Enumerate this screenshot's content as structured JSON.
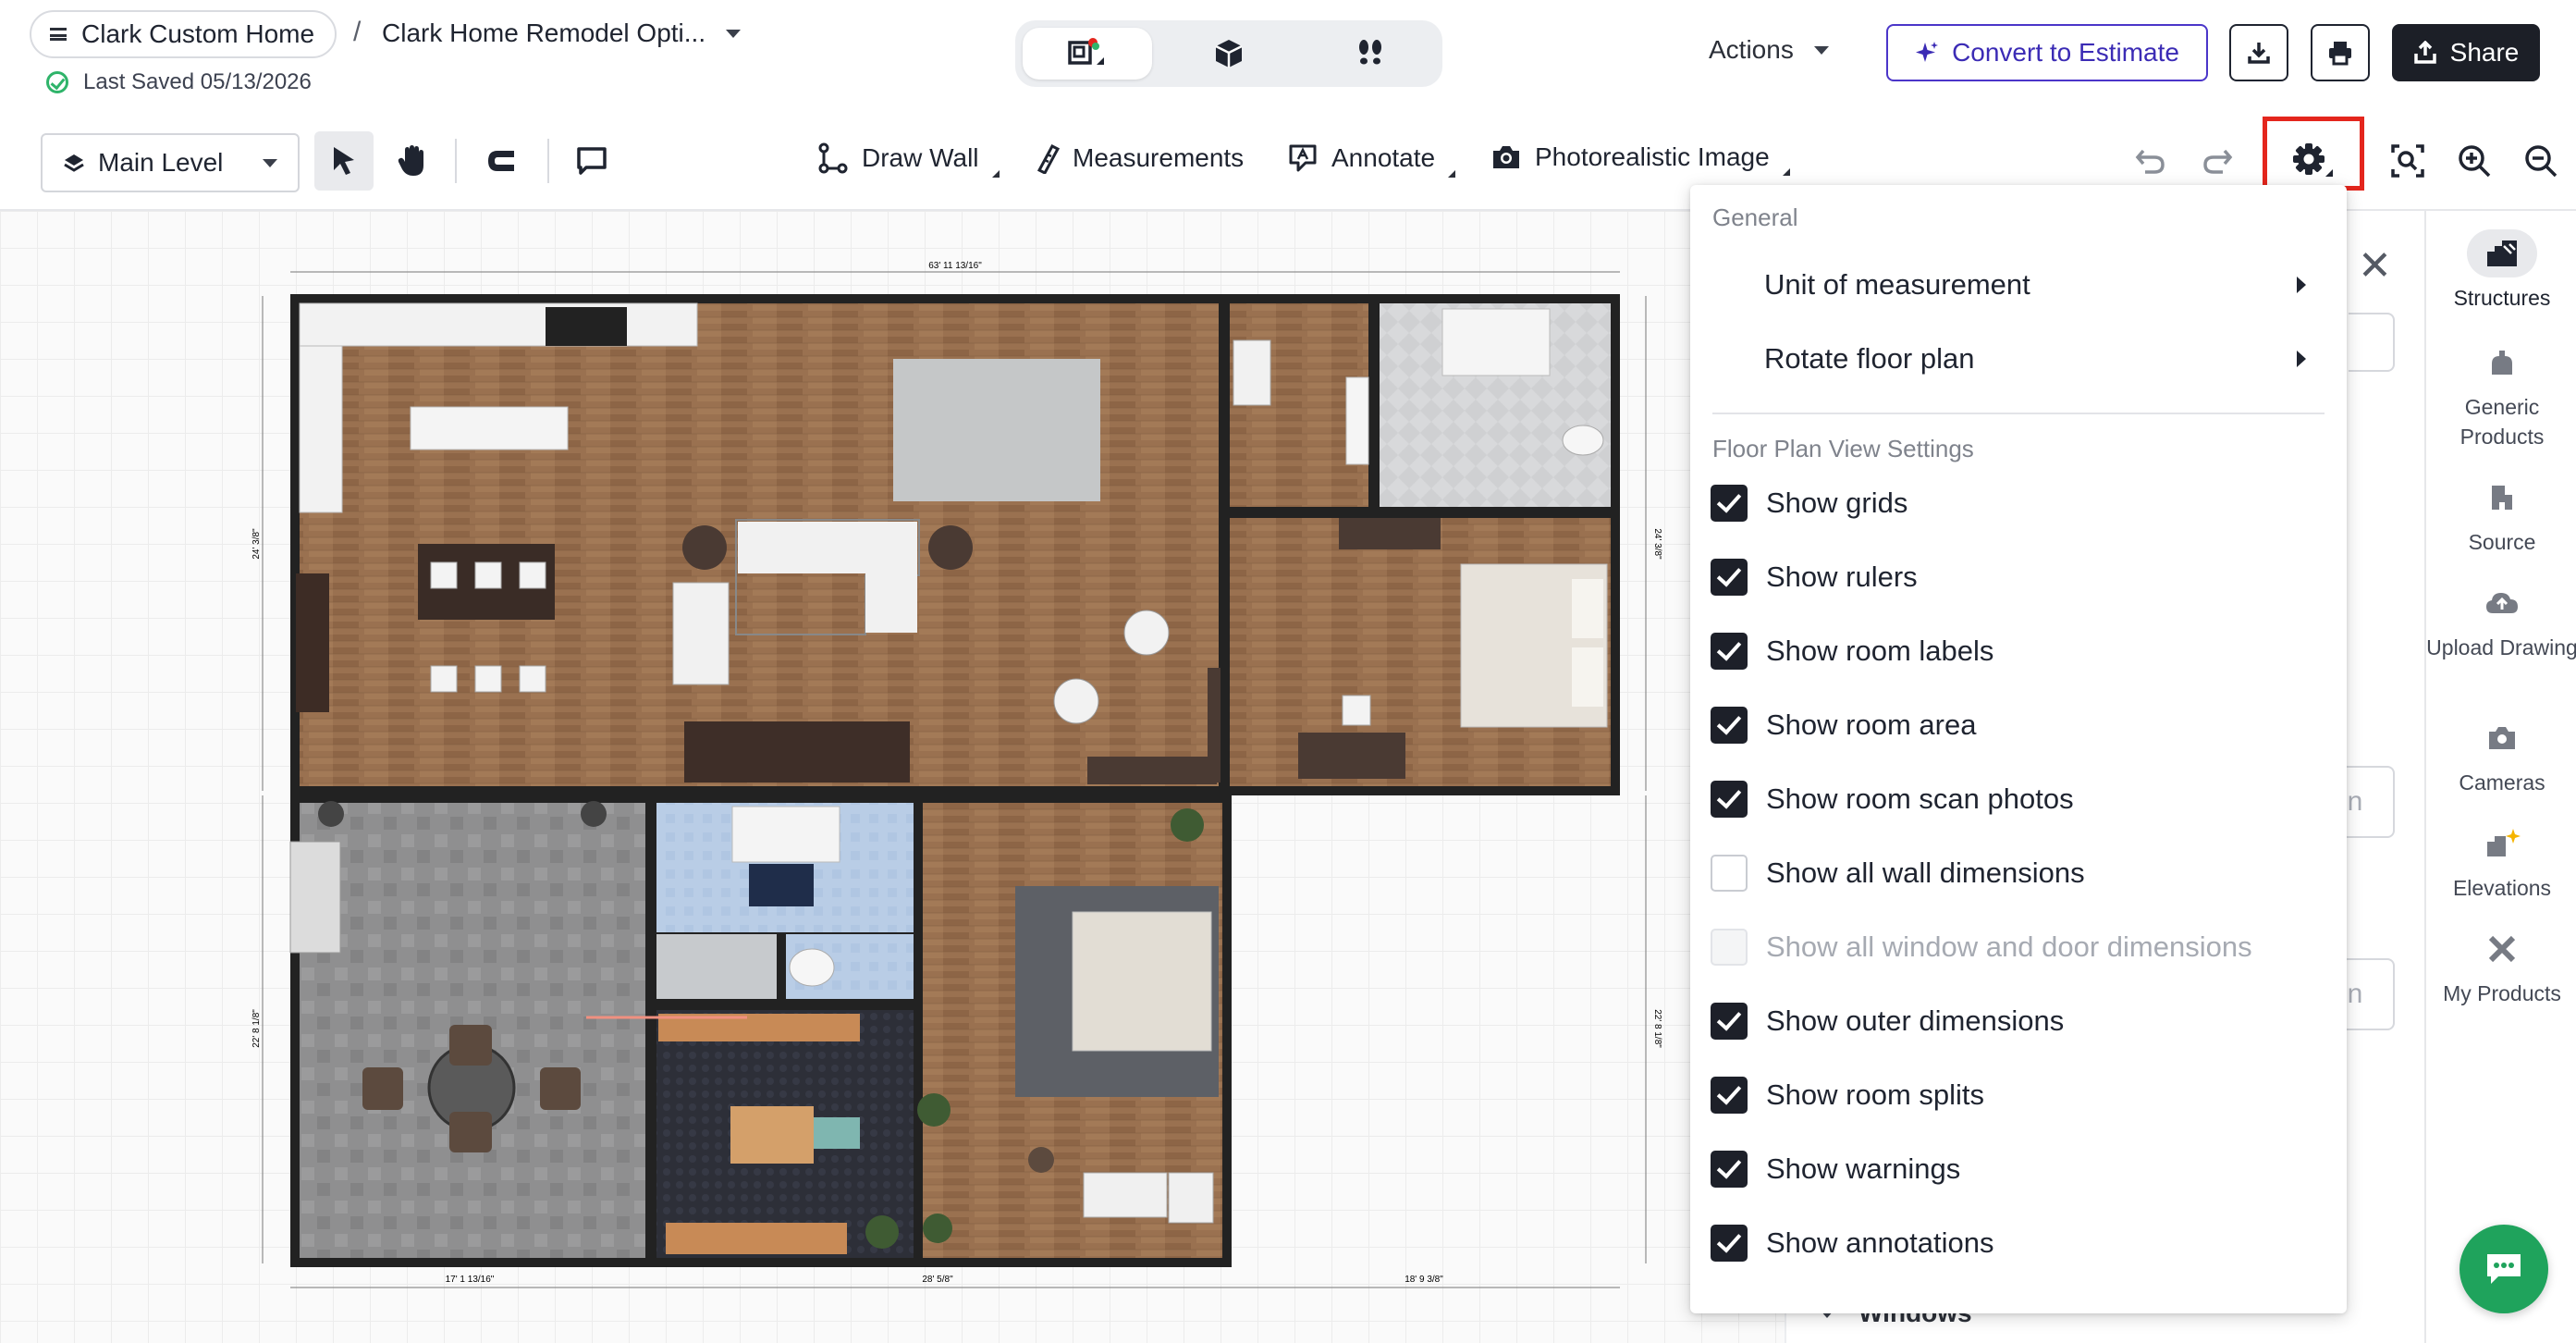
{
  "header": {
    "project_name": "Clark Custom Home",
    "breadcrumb_sep": "/",
    "plan_name": "Clark Home Remodel Opti...",
    "last_saved": "Last Saved 05/13/2026",
    "actions_label": "Actions",
    "convert_label": "Convert to Estimate",
    "share_label": "Share",
    "view_modes": [
      "floor-plan-2d",
      "3d-view",
      "walkthrough"
    ],
    "active_view": "floor-plan-2d"
  },
  "toolbar": {
    "level": "Main Level",
    "draw_wall": "Draw Wall",
    "measurements": "Measurements",
    "annotate": "Annotate",
    "photorealistic": "Photorealistic Image"
  },
  "floorplan": {
    "dim_top": "63' 11 13/16\"",
    "dim_left_upper": "24' 3/8\"",
    "dim_left_lower": "22' 8 1/8\"",
    "dim_right_upper": "24' 3/8\"",
    "dim_right_lower": "22' 8 1/8\"",
    "dim_bottom_1": "17' 1 13/16\"",
    "dim_bottom_2": "28' 5/8\"",
    "dim_bottom_3": "18' 9 3/8\""
  },
  "settings_menu": {
    "general_heading": "General",
    "unit_of_measurement": "Unit of measurement",
    "rotate_floor_plan": "Rotate floor plan",
    "view_heading": "Floor Plan View Settings",
    "options": [
      {
        "label": "Show grids",
        "state": "checked"
      },
      {
        "label": "Show rulers",
        "state": "checked"
      },
      {
        "label": "Show room labels",
        "state": "checked"
      },
      {
        "label": "Show room area",
        "state": "checked"
      },
      {
        "label": "Show room scan photos",
        "state": "checked"
      },
      {
        "label": "Show all wall dimensions",
        "state": "unchecked"
      },
      {
        "label": "Show all window and door dimensions",
        "state": "disabled"
      },
      {
        "label": "Show outer dimensions",
        "state": "checked"
      },
      {
        "label": "Show room splits",
        "state": "checked"
      },
      {
        "label": "Show warnings",
        "state": "checked"
      },
      {
        "label": "Show annotations",
        "state": "checked"
      }
    ]
  },
  "panel": {
    "unit_suffix_1": "in",
    "unit_suffix_2": "in",
    "windows_label": "Windows"
  },
  "sidenav": {
    "items": [
      {
        "label": "Structures",
        "icon": "structures-icon"
      },
      {
        "label": "Generic Products",
        "icon": "generic-products-icon"
      },
      {
        "label": "Source",
        "icon": "source-icon"
      },
      {
        "label": "Upload Drawing",
        "icon": "upload-icon"
      },
      {
        "label": "Cameras",
        "icon": "camera-icon"
      },
      {
        "label": "Elevations",
        "icon": "elevations-icon"
      },
      {
        "label": "My Products",
        "icon": "my-products-icon"
      }
    ]
  },
  "colors": {
    "accent": "#3b2bb5",
    "highlight": "#e4261d",
    "chat": "#1fa35c",
    "checkbox_on": "#1d2029"
  }
}
